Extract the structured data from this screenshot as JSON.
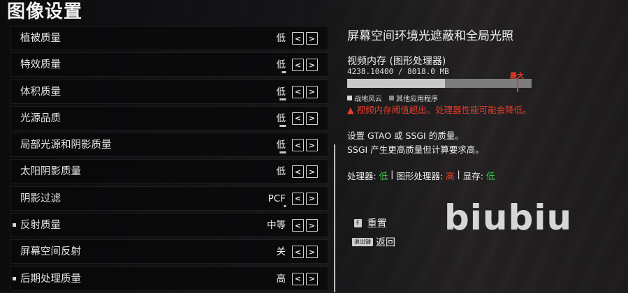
{
  "page_title": "图像设置",
  "settings": [
    {
      "label": "植被质量",
      "value": "低",
      "marker": false,
      "dots": ""
    },
    {
      "label": "特效质量",
      "value": "低",
      "marker": false,
      "dots": "▪▪"
    },
    {
      "label": "体积质量",
      "value": "低",
      "marker": false,
      "dots": "▪▪▪"
    },
    {
      "label": "光源品质",
      "value": "低",
      "marker": false,
      "dots": "▪▪▪"
    },
    {
      "label": "局部光源和阴影质量",
      "value": "低",
      "marker": false,
      "dots": "▪▪▪"
    },
    {
      "label": "太阳阴影质量",
      "value": "低",
      "marker": false,
      "dots": ""
    },
    {
      "label": "阴影过滤",
      "value": "PCF",
      "marker": false,
      "dots": "▪"
    },
    {
      "label": "反射质量",
      "value": "中等",
      "marker": true,
      "dots": ""
    },
    {
      "label": "屏幕空间反射",
      "value": "关",
      "marker": false,
      "dots": ""
    },
    {
      "label": "后期处理质量",
      "value": "高",
      "marker": true,
      "dots": ""
    }
  ],
  "arrow_left": "<",
  "arrow_right": ">",
  "detail": {
    "title": "屏幕空间环境光遮蔽和全局光照",
    "vram_label": "视频内存 (图形处理器)",
    "vram_numbers": "4238.10400 / 8018.0 MB",
    "vram_used_fraction": 0.5286,
    "vram_max_fraction": 0.92,
    "max_label": "最大",
    "legend": [
      {
        "label": "战地风云",
        "color": "#d8d8d8"
      },
      {
        "label": "其他应用程序",
        "color": "#8a8a8a"
      }
    ],
    "warning_icon": "▲",
    "warning": "视频内存阈值超出。处理器性能可能会降低。",
    "description_line1": "设置 GTAO 或 SSGI 的质量。",
    "description_line2": "SSGI 产生更高质量但计算要求高。",
    "impact": {
      "cpu_label": "处理器: ",
      "cpu_value": "低",
      "sep1": " | ",
      "gpu_label": "图形处理器: ",
      "gpu_value": "高",
      "sep2": " | ",
      "vram_label": "显存: ",
      "vram_value": "低"
    },
    "reset_key": "F",
    "reset_label": "重置",
    "back_key": "退出键",
    "back_label": "返回"
  },
  "watermark": "biubiu",
  "colors": {
    "warning": "#e83c2a",
    "low": "#3fd14a",
    "high": "#e8402a"
  }
}
